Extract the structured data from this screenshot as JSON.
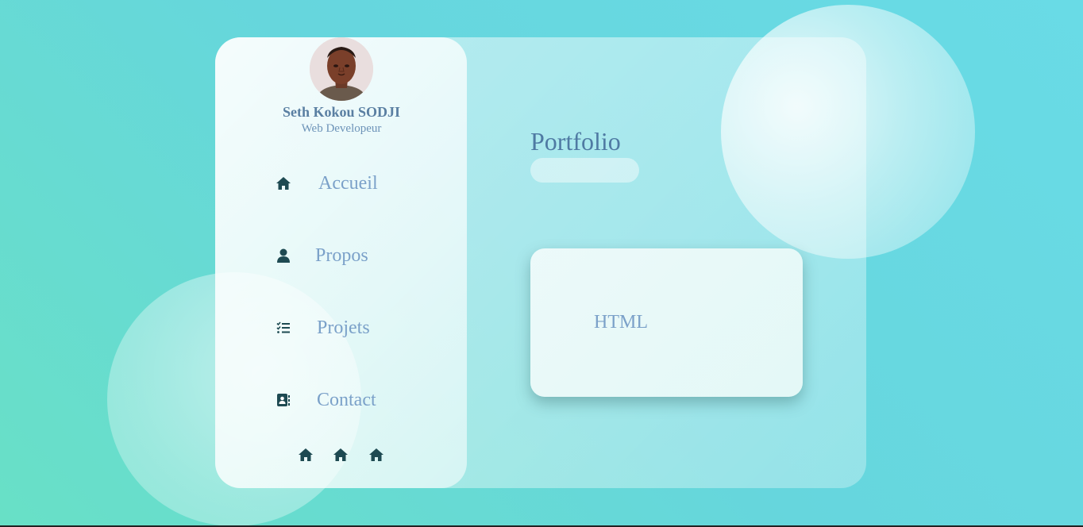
{
  "profile": {
    "name": "Seth Kokou SODJI",
    "role": "Web Developeur"
  },
  "nav": {
    "items": [
      {
        "label": "Accueil",
        "icon": "home-icon"
      },
      {
        "label": "Propos",
        "icon": "user-icon"
      },
      {
        "label": "Projets",
        "icon": "task-list-icon"
      },
      {
        "label": "Contact",
        "icon": "address-book-icon"
      }
    ]
  },
  "social": {
    "icons": [
      "home-icon",
      "home-icon",
      "home-icon"
    ]
  },
  "main": {
    "title": "Portfolio",
    "cards": [
      {
        "label": "HTML"
      }
    ]
  },
  "colors": {
    "accent_text": "#7ba1c9",
    "title_text": "#4f7aa3",
    "icon": "#1e4a52",
    "background_start": "#68e0c6",
    "background_end": "#69dbe6"
  }
}
